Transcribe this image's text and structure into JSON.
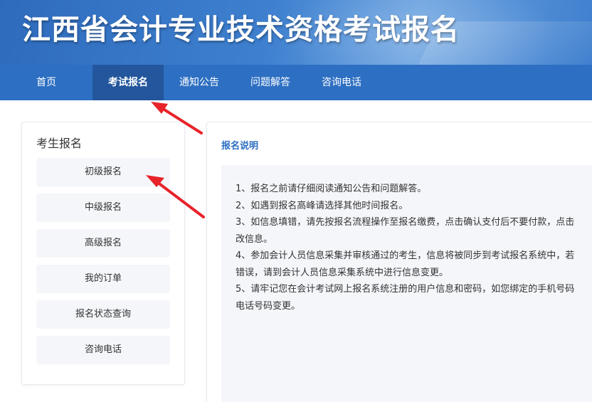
{
  "header": {
    "site_title": "江西省会计专业技术资格考试报名"
  },
  "nav": {
    "items": [
      {
        "label": "首页"
      },
      {
        "label": "考试报名"
      },
      {
        "label": "通知公告"
      },
      {
        "label": "问题解答"
      },
      {
        "label": "咨询电话"
      }
    ],
    "active_index": 1
  },
  "sidebar": {
    "title": "考生报名",
    "items": [
      {
        "label": "初级报名"
      },
      {
        "label": "中级报名"
      },
      {
        "label": "高级报名"
      },
      {
        "label": "我的订单"
      },
      {
        "label": "报名状态查询"
      },
      {
        "label": "咨询电话"
      }
    ]
  },
  "main": {
    "title": "报名说明",
    "lines": [
      "1、报名之前请仔细阅读通知公告和问题解答。",
      "2、如遇到报名高峰请选择其他时间报名。",
      "3、如信息填错，请先按报名流程操作至报名缴费，点击确认支付后不要付款，点击",
      "改信息。",
      "4、参加会计人员信息采集并审核通过的考生，信息将被同步到考试报名系统中，若",
      "错误，请到会计人员信息采集系统中进行信息变更。",
      "5、请牢记您在会计考试网上报名系统注册的用户信息和密码，如您绑定的手机号码",
      "电话号码变更。"
    ]
  },
  "colors": {
    "nav_bg": "#2d6fc2",
    "nav_active_bg": "#23569c",
    "title_accent": "#2d6fc2",
    "arrow": "#e8232a"
  },
  "icons": [
    "arrow-to-nav-icon",
    "arrow-to-primary-icon"
  ]
}
